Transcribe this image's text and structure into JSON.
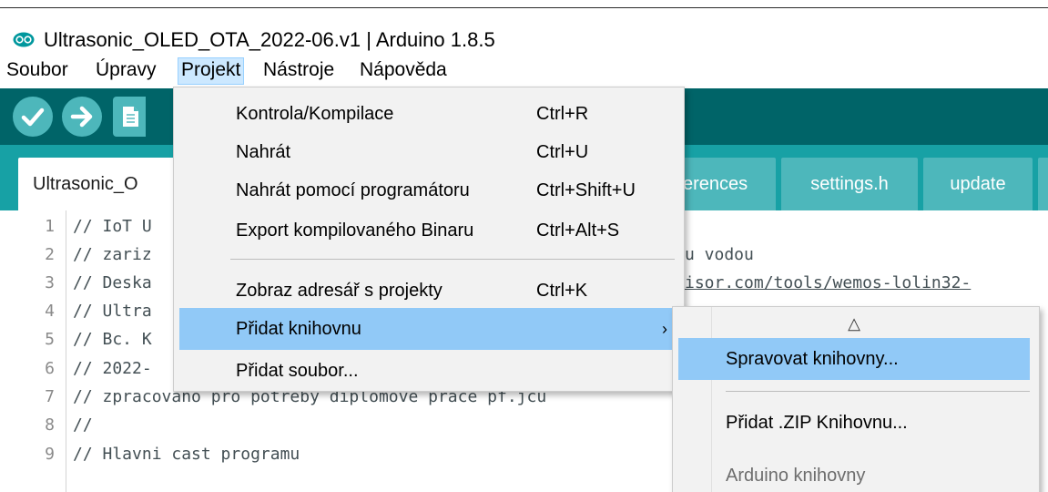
{
  "window": {
    "title": "Ultrasonic_OLED_OTA_2022-06.v1 | Arduino 1.8.5"
  },
  "menubar": {
    "items": [
      "Soubor",
      "Úpravy",
      "Projekt",
      "Nástroje",
      "Nápověda"
    ],
    "active": "Projekt"
  },
  "toolbar": {
    "icons": [
      "verify-icon",
      "upload-icon",
      "new-sketch-icon"
    ]
  },
  "tabs": [
    {
      "label": "Ultrasonic_O",
      "active": true
    },
    {
      "label": "erences",
      "active": false
    },
    {
      "label": "settings.h",
      "active": false
    },
    {
      "label": "update",
      "active": false
    }
  ],
  "editor": {
    "lines": [
      {
        "num": "1",
        "text": "// IoT U"
      },
      {
        "num": "2",
        "text": "// zariz"
      },
      {
        "num": "3",
        "text": "// Deska"
      },
      {
        "num": "4",
        "text": "// Ultra"
      },
      {
        "num": "5",
        "text": "// Bc. K"
      },
      {
        "num": "6",
        "text": "// 2022-"
      },
      {
        "num": "7",
        "text": "// zpracovano pro potreby diplomove prace pf.jcu"
      },
      {
        "num": "8",
        "text": "//"
      },
      {
        "num": "9",
        "text": "// Hlavni cast programu"
      }
    ],
    "fragments": {
      "line2": "u vodou",
      "line3": "isor.com/tools/wemos-lolin32-"
    }
  },
  "project_menu": {
    "items": [
      {
        "label": "Kontrola/Kompilace",
        "shortcut": "Ctrl+R"
      },
      {
        "label": "Nahrát",
        "shortcut": "Ctrl+U"
      },
      {
        "label": "Nahrát pomocí programátoru",
        "shortcut": "Ctrl+Shift+U"
      },
      {
        "label": "Export kompilovaného Binaru",
        "shortcut": "Ctrl+Alt+S"
      },
      {
        "label": "Zobraz adresář s projekty",
        "shortcut": "Ctrl+K"
      },
      {
        "label": "Přidat knihovnu",
        "shortcut": "",
        "submenu_arrow": "›"
      },
      {
        "label": "Přidat soubor...",
        "shortcut": ""
      }
    ],
    "highlighted": "Přidat knihovnu"
  },
  "library_submenu": {
    "scroll_up": "△",
    "items": [
      {
        "label": "Spravovat knihovny..."
      },
      {
        "label": "Přidat .ZIP Knihovnu..."
      },
      {
        "label": "Arduino knihovny"
      }
    ],
    "highlighted": "Spravovat knihovny..."
  },
  "colors": {
    "toolbar_bg": "#006468",
    "tabs_bg": "#17a1a5",
    "button_bg": "#4db7bb",
    "menu_bg": "#f2f2f2",
    "menu_highlight": "#91c9f7",
    "menubar_active": "#cce8ff"
  }
}
